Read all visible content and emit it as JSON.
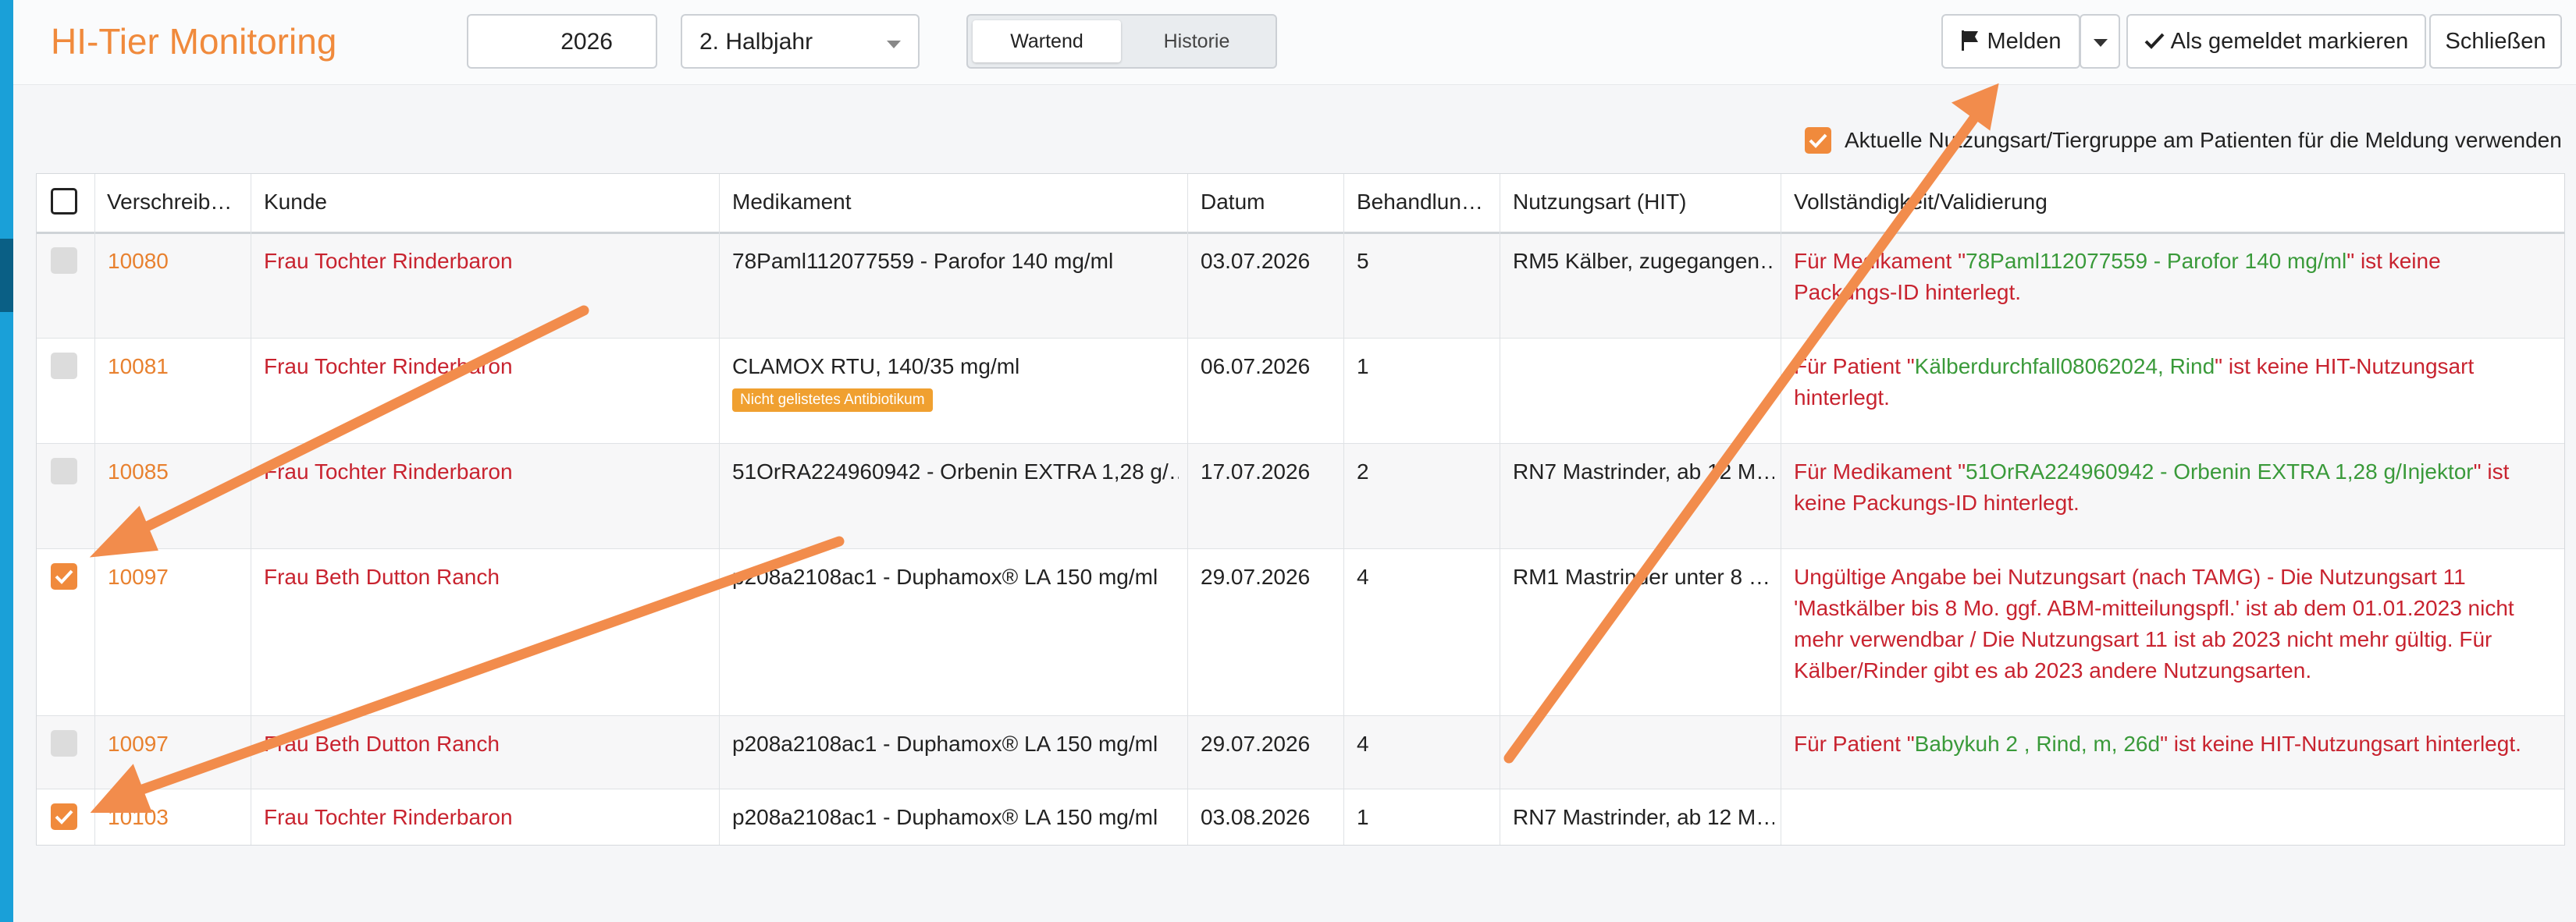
{
  "header": {
    "title": "HI-Tier Monitoring",
    "year": "2026",
    "period": "2. Halbjahr",
    "tabs": [
      "Wartend",
      "Historie"
    ],
    "buttons": {
      "melden": "Melden",
      "mark_reported": "Als gemeldet markieren",
      "close": "Schließen"
    }
  },
  "option": {
    "checked": true,
    "label": "Aktuelle Nutzungsart/Tiergruppe am Patienten für die Meldung verwenden"
  },
  "table": {
    "columns": [
      "Verschreib…",
      "Kunde",
      "Medikament",
      "Datum",
      "Behandlun…",
      "Nutzungsart (HIT)",
      "Vollständigkeit/Validierung"
    ],
    "rows": [
      {
        "checkbox": "disabled",
        "id": "10080",
        "customer": "Frau Tochter Rinderbaron",
        "medication": "78Paml112077559 - Parofor 140 mg/ml",
        "date": "03.07.2026",
        "treatment": "5",
        "usage": "RM5 Kälber, zugegangen…",
        "validation": [
          {
            "text": "Für Medikament \"",
            "color": "red"
          },
          {
            "text": "78Paml112077559 - Parofor 140 mg/ml",
            "color": "green"
          },
          {
            "text": "\" ist keine",
            "color": "red"
          },
          {
            "text": "\n",
            "color": "red"
          },
          {
            "text": "Packungs-ID hinterlegt.",
            "color": "red"
          }
        ]
      },
      {
        "checkbox": "disabled",
        "id": "10081",
        "customer": "Frau Tochter Rinderbaron",
        "medication": "CLAMOX RTU, 140/35 mg/ml",
        "badge": "Nicht gelistetes Antibiotikum",
        "date": "06.07.2026",
        "treatment": "1",
        "usage": "",
        "validation": [
          {
            "text": "Für Patient \"",
            "color": "red"
          },
          {
            "text": "Kälberdurchfall08062024, Rind",
            "color": "green"
          },
          {
            "text": "\" ist keine HIT-Nutzungsart",
            "color": "red"
          },
          {
            "text": "\n",
            "color": "red"
          },
          {
            "text": "hinterlegt.",
            "color": "red"
          }
        ]
      },
      {
        "checkbox": "disabled",
        "id": "10085",
        "customer": "Frau Tochter Rinderbaron",
        "medication": "51OrRA224960942 - Orbenin EXTRA 1,28 g/…",
        "date": "17.07.2026",
        "treatment": "2",
        "usage": "RN7 Mastrinder, ab 12 M…",
        "validation": [
          {
            "text": "Für Medikament \"",
            "color": "red"
          },
          {
            "text": "51OrRA224960942 - Orbenin EXTRA 1,28 g/Injektor",
            "color": "green"
          },
          {
            "text": "\" ist",
            "color": "red"
          },
          {
            "text": "\n",
            "color": "red"
          },
          {
            "text": "keine Packungs-ID hinterlegt.",
            "color": "red"
          }
        ]
      },
      {
        "checkbox": "checked",
        "id": "10097",
        "customer": "Frau Beth Dutton Ranch",
        "medication": "p208a2108ac1 - Duphamox® LA 150 mg/ml",
        "date": "29.07.2026",
        "treatment": "4",
        "usage": "RM1 Mastrinder unter 8 …",
        "validation": [
          {
            "text": "Ungültige Angabe bei Nutzungsart (nach TAMG) - Die Nutzungsart 11",
            "color": "red"
          },
          {
            "text": "\n",
            "color": "red"
          },
          {
            "text": "'Mastkälber bis 8 Mo. ggf. ABM-mitteilungspfl.' ist ab dem 01.01.2023 nicht",
            "color": "red"
          },
          {
            "text": "\n",
            "color": "red"
          },
          {
            "text": "mehr verwendbar / Die Nutzungsart 11 ist ab 2023 nicht mehr gültig. Für",
            "color": "red"
          },
          {
            "text": "\n",
            "color": "red"
          },
          {
            "text": "Kälber/Rinder gibt es ab 2023 andere Nutzungsarten.",
            "color": "red"
          }
        ]
      },
      {
        "checkbox": "disabled",
        "id": "10097",
        "customer": "Frau Beth Dutton Ranch",
        "medication": "p208a2108ac1 - Duphamox® LA 150 mg/ml",
        "date": "29.07.2026",
        "treatment": "4",
        "usage": "",
        "validation": [
          {
            "text": "Für Patient \"",
            "color": "red"
          },
          {
            "text": "Babykuh 2 , Rind, m, 26d",
            "color": "green"
          },
          {
            "text": "\" ist keine HIT-Nutzungsart hinterlegt.",
            "color": "red"
          }
        ]
      },
      {
        "checkbox": "checked",
        "id": "10103",
        "customer": "Frau Tochter Rinderbaron",
        "medication": "p208a2108ac1 - Duphamox® LA 150 mg/ml",
        "date": "03.08.2026",
        "treatment": "1",
        "usage": "RN7 Mastrinder, ab 12 M…",
        "validation": []
      }
    ]
  },
  "colors": {
    "accent": "#f08a3c",
    "sidebar": "#1aa0d8",
    "error": "#c8232f",
    "ok": "#3a9a3a"
  }
}
